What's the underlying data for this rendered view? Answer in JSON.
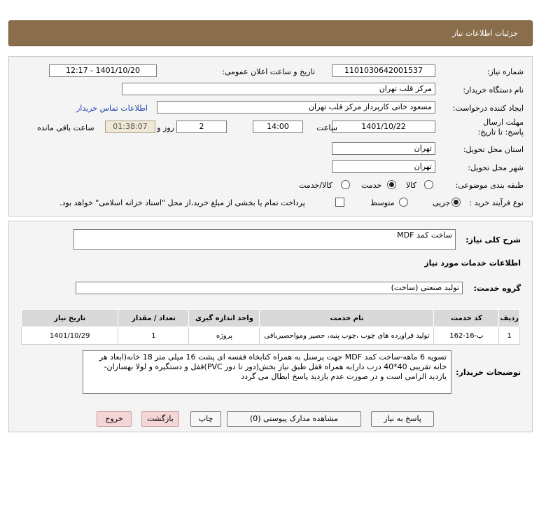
{
  "header": {
    "title": "جزئیات اطلاعات نیاز"
  },
  "form": {
    "need_number_label": "شماره نیاز:",
    "need_number": "1101030642001537",
    "announce_label": "تاریخ و ساعت اعلان عمومی:",
    "announce_value": "1401/10/20 - 12:17",
    "buyer_label": "نام دستگاه خریدار:",
    "buyer": "مرکز قلب تهران",
    "creator_label": "ایجاد کننده درخواست:",
    "creator": "مسعود خاتی کارپرداز مرکز قلب تهران",
    "contact_link": "اطلاعات تماس خریدار",
    "deadline_label": "مهلت ارسال پاسخ: تا تاریخ:",
    "deadline_date": "1401/10/22",
    "time_label": "ساعت",
    "deadline_time": "14:00",
    "days": "2",
    "days_label": "روز و",
    "remaining": "01:38:07",
    "remaining_label": "ساعت باقی مانده",
    "province_label": "استان محل تحویل:",
    "province": "تهران",
    "city_label": "شهر محل تحویل:",
    "city": "تهران",
    "category_label": "طبقه بندی موضوعی:",
    "category_options": [
      "کالا",
      "خدمت",
      "کالا/خدمت"
    ],
    "category_selected": "خدمت",
    "process_label": "نوع فرآیند خرید :",
    "process_options": [
      "جزیی",
      "متوسط"
    ],
    "process_selected": "جزیی",
    "treasury_note": "پرداخت تمام یا بخشی از مبلغ خرید،از محل \"اسناد خزانه اسلامی\" خواهد بود."
  },
  "details": {
    "summary_label": "شرح کلی نیاز:",
    "summary": "ساخت کمد MDF",
    "services_heading": "اطلاعات خدمات مورد نیاز",
    "service_group_label": "گروه خدمت:",
    "service_group": "تولید صنعتی (ساخت)",
    "table": {
      "headers": [
        "ردیف",
        "کد خدمت",
        "نام خدمت",
        "واحد اندازه گیری",
        "تعداد / مقدار",
        "تاریخ نیاز"
      ],
      "rows": [
        [
          "1",
          "پ-16-162",
          "تولید فراورده های چوب ،چوب پنبه، حصیر ومواحصیربافی",
          "پروژه",
          "1",
          "1401/10/29"
        ]
      ]
    },
    "buyer_notes_label": "توضیحات خریدار:",
    "buyer_notes": "تسویه 6 ماهه-ساخت کمد MDF جهت پرسنل به همراه کتابخاه قفسه ای پشت 16 میلی متر 18 خانه(ابعاد هر خانه تقریبی 40*40 درب دار)به همراه قفل طبق نیاز بخش(دور تا دور PVC)قفل و دستگیره و لولا بهسازان-بازدید الزامی است و در صورت عدم بازدید پاسخ ابطال می گردد"
  },
  "buttons": {
    "reply": "پاسخ به نیاز",
    "attachments": "مشاهده مدارک پیوستی (0)",
    "print": "چاپ",
    "back": "بازگشت",
    "exit": "خروج"
  }
}
